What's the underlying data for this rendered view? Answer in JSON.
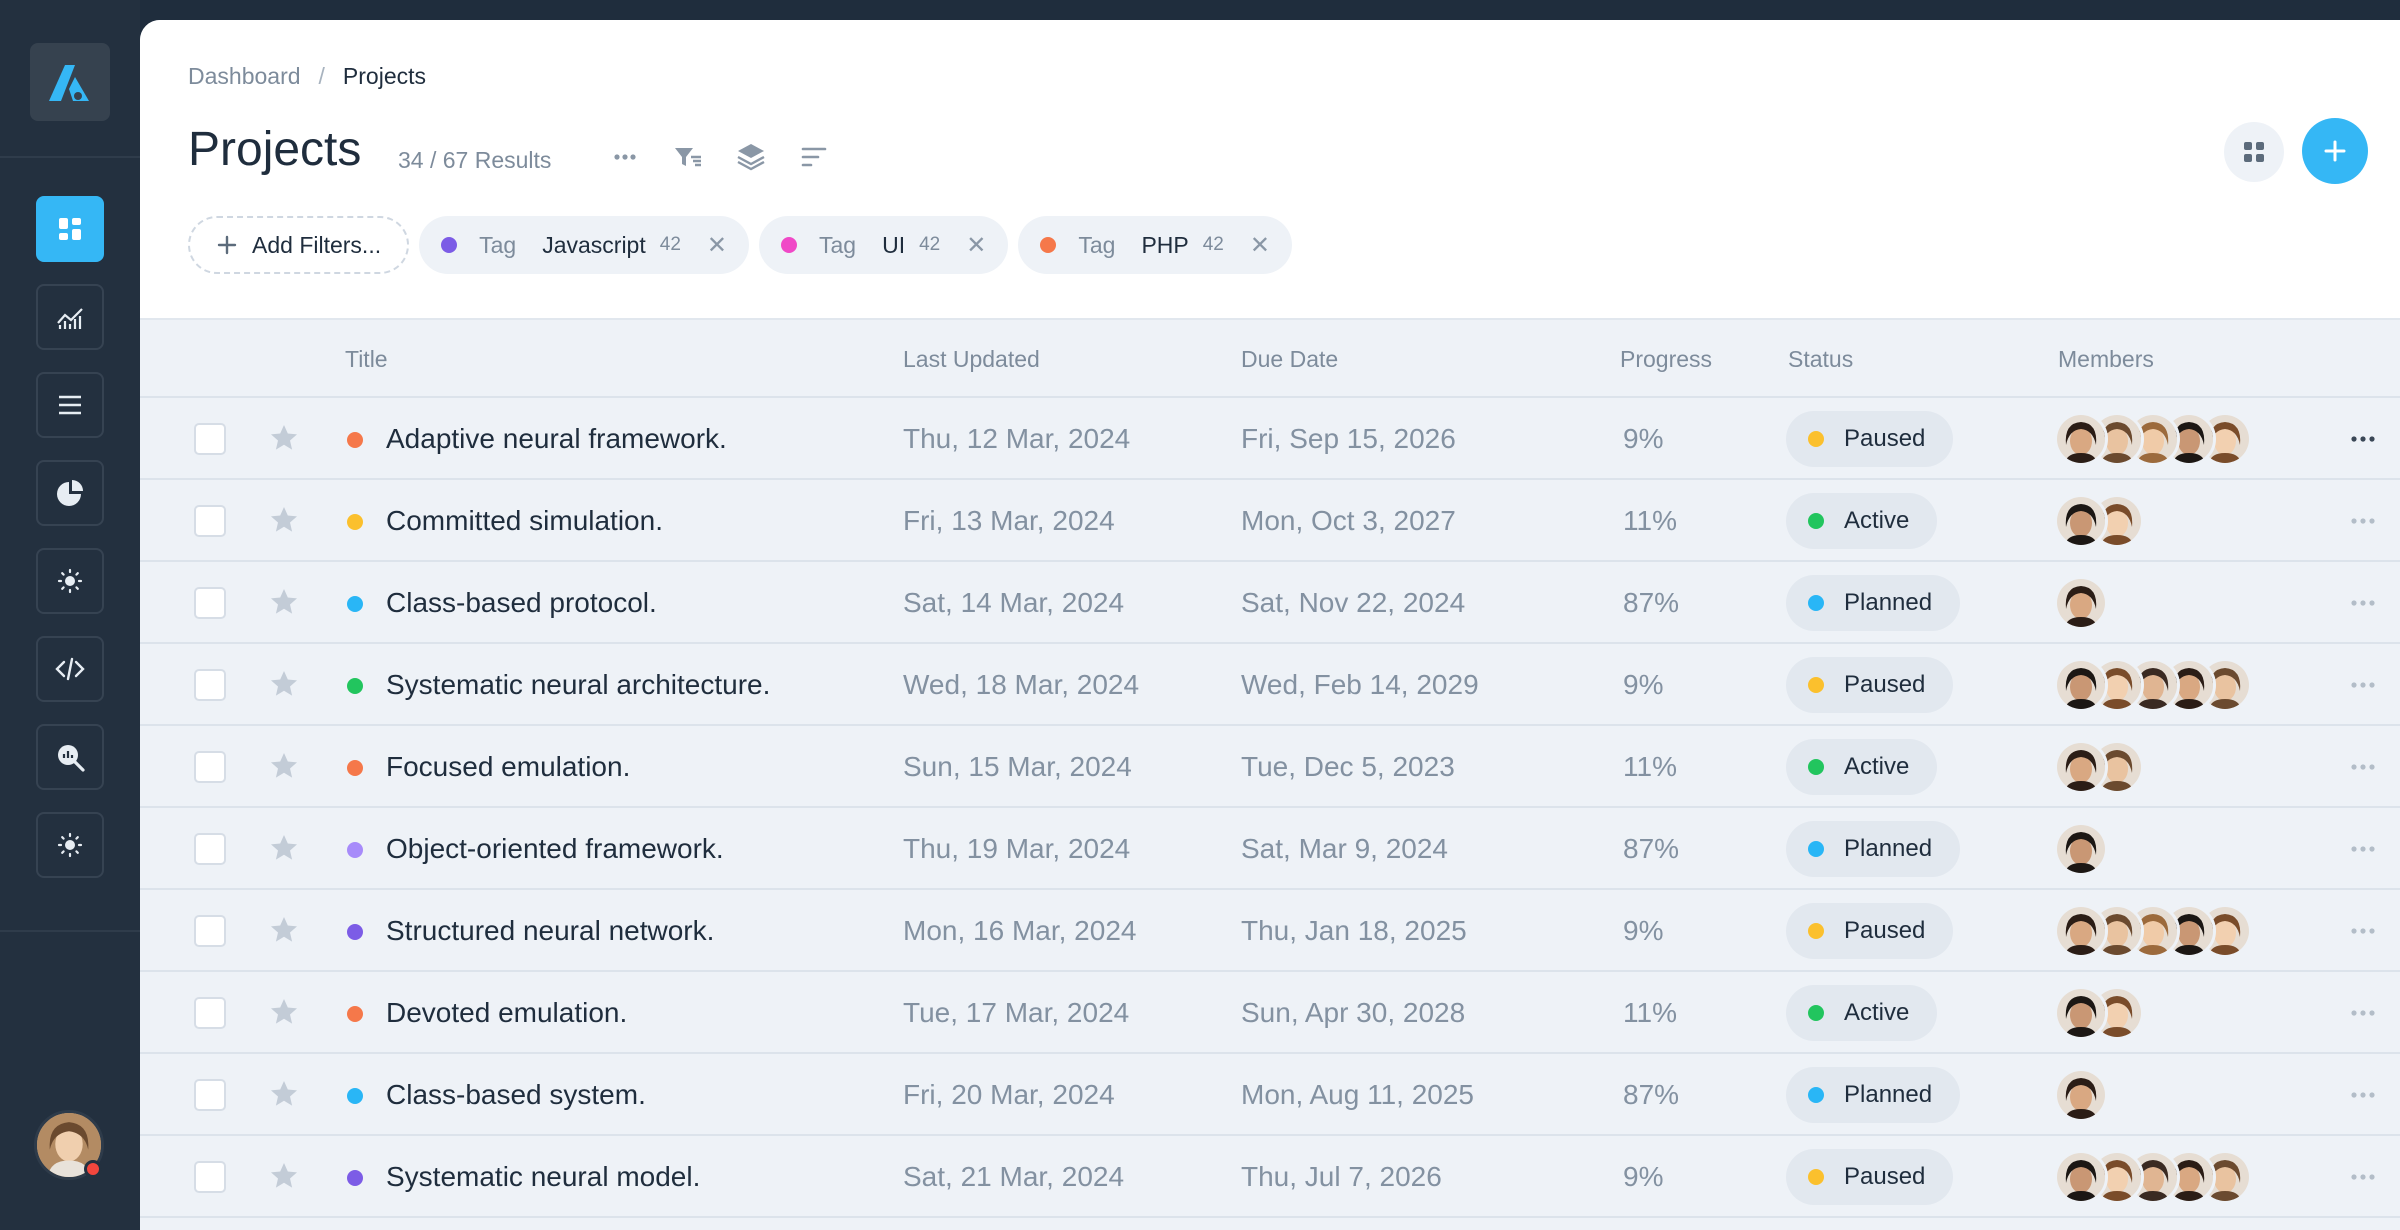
{
  "sidebar": {
    "logo_icon": "brand-logo-icon",
    "items": [
      {
        "name": "dashboard-icon",
        "active": true
      },
      {
        "name": "analytics-chart-icon",
        "active": false
      },
      {
        "name": "list-icon",
        "active": false
      },
      {
        "name": "pie-chart-icon",
        "active": false
      },
      {
        "name": "sun-icon",
        "active": false
      },
      {
        "name": "code-icon",
        "active": false
      },
      {
        "name": "search-analytics-icon",
        "active": false
      },
      {
        "name": "settings-sun-icon",
        "active": false
      }
    ],
    "user_status_color": "#f2463d"
  },
  "breadcrumb": {
    "parent": "Dashboard",
    "separator": "/",
    "current": "Projects"
  },
  "header": {
    "title": "Projects",
    "results": "34 / 67 Results",
    "accent_color": "#35b7f5"
  },
  "filters": {
    "add_label": "Add Filters...",
    "chips": [
      {
        "key": "Tag",
        "value": "Javascript",
        "count": "42",
        "color": "#7c5ce6"
      },
      {
        "key": "Tag",
        "value": "UI",
        "count": "42",
        "color": "#f049c7"
      },
      {
        "key": "Tag",
        "value": "PHP",
        "count": "42",
        "color": "#f5784a"
      }
    ]
  },
  "table": {
    "columns": {
      "title": "Title",
      "updated": "Last Updated",
      "due": "Due Date",
      "progress": "Progress",
      "status": "Status",
      "members": "Members"
    },
    "rows": [
      {
        "title": "Adaptive neural framework.",
        "color": "#f5784a",
        "updated": "Thu, 12 Mar, 2024",
        "due": "Fri, Sep 15, 2026",
        "progress": "9%",
        "status": "Paused",
        "members": 5
      },
      {
        "title": "Committed simulation.",
        "color": "#fbc02d",
        "updated": "Fri, 13 Mar, 2024",
        "due": "Mon, Oct 3, 2027",
        "progress": "11%",
        "status": "Active",
        "members": 2
      },
      {
        "title": "Class-based protocol.",
        "color": "#29b6f6",
        "updated": "Sat, 14 Mar, 2024",
        "due": "Sat, Nov 22, 2024",
        "progress": "87%",
        "status": "Planned",
        "members": 1
      },
      {
        "title": "Systematic neural architecture.",
        "color": "#22c55e",
        "updated": "Wed, 18 Mar, 2024",
        "due": "Wed, Feb 14, 2029",
        "progress": "9%",
        "status": "Paused",
        "members": 5
      },
      {
        "title": "Focused emulation.",
        "color": "#f5784a",
        "updated": "Sun, 15 Mar, 2024",
        "due": "Tue, Dec 5, 2023",
        "progress": "11%",
        "status": "Active",
        "members": 2
      },
      {
        "title": "Object-oriented framework.",
        "color": "#a78bfa",
        "updated": "Thu, 19 Mar, 2024",
        "due": "Sat, Mar 9, 2024",
        "progress": "87%",
        "status": "Planned",
        "members": 1
      },
      {
        "title": "Structured neural network.",
        "color": "#7c5ce6",
        "updated": "Mon, 16 Mar, 2024",
        "due": "Thu, Jan 18, 2025",
        "progress": "9%",
        "status": "Paused",
        "members": 5
      },
      {
        "title": "Devoted emulation.",
        "color": "#f5784a",
        "updated": "Tue, 17 Mar, 2024",
        "due": "Sun, Apr 30, 2028",
        "progress": "11%",
        "status": "Active",
        "members": 2
      },
      {
        "title": "Class-based system.",
        "color": "#29b6f6",
        "updated": "Fri, 20 Mar, 2024",
        "due": "Mon, Aug 11, 2025",
        "progress": "87%",
        "status": "Planned",
        "members": 1
      },
      {
        "title": "Systematic neural model.",
        "color": "#7c5ce6",
        "updated": "Sat, 21 Mar, 2024",
        "due": "Thu, Jul 7, 2026",
        "progress": "9%",
        "status": "Paused",
        "members": 5
      }
    ],
    "status_colors": {
      "Paused": "#fbc02d",
      "Active": "#22c55e",
      "Planned": "#29b6f6"
    }
  }
}
